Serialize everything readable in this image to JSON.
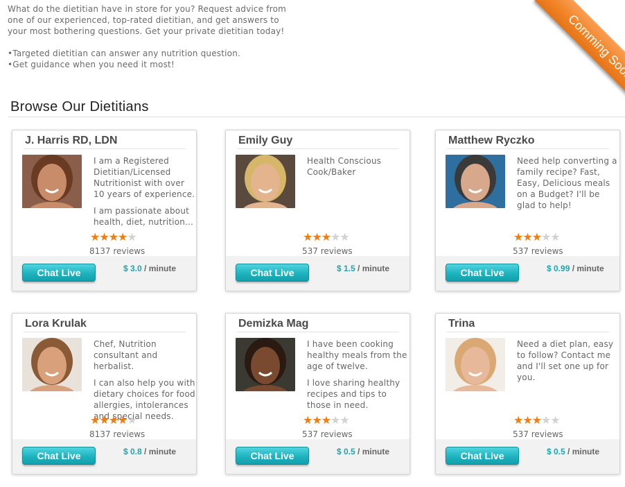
{
  "intro": {
    "paragraph": "What do the dietitian have in store for you? Request advice from one of our experienced, top-rated dietitian, and get answers to your most bothering questions. Get your private dietitian today!",
    "bullet_1": "•Targeted dietitian can answer any nutrition question.",
    "bullet_2": "•Get guidance when you need it most!"
  },
  "ribbon": {
    "label": "Comming Soon",
    "color": "#f08224"
  },
  "section_title": "Browse Our Dietitians",
  "ui": {
    "chat_label": "Chat Live",
    "per_minute": "/ minute",
    "accent": "#1eb3bf",
    "star_color": "#f07c12"
  },
  "dietitians": [
    {
      "name": "J. Harris RD, LDN",
      "desc": [
        "I am a Registered Dietitian/Licensed Nutritionist with over 10 years of experience.",
        "I am passionate about health, diet, nutrition..."
      ],
      "rating": 4,
      "reviews": "8137 reviews",
      "price": "$ 3.0",
      "skin": "#c98c6a",
      "hair": "#6a3a22",
      "bg": "#8a5e4a"
    },
    {
      "name": "Emily Guy",
      "desc": [
        "Health Conscious Cook/Baker"
      ],
      "rating": 3,
      "reviews": "537 reviews",
      "price": "$ 1.5",
      "skin": "#e3b48e",
      "hair": "#d6b76a",
      "bg": "#5a4a3e"
    },
    {
      "name": "Matthew Ryczko",
      "desc": [
        "Need help converting a family recipe? Fast, Easy, Delicious meals on a Budget? I'll be glad to help!"
      ],
      "rating": 3,
      "reviews": "537 reviews",
      "price": "$ 0.99",
      "skin": "#d8a88c",
      "hair": "#3a3a3a",
      "bg": "#2e6fa0"
    },
    {
      "name": "Lora Krulak",
      "desc": [
        "Chef, Nutrition consultant and herbalist.",
        "I can also help you with dietary choices for food allergies, intolerances and special needs."
      ],
      "rating": 4,
      "reviews": "8137 reviews",
      "price": "$ 0.8",
      "skin": "#d9a07c",
      "hair": "#8a5a36",
      "bg": "#e9e2da"
    },
    {
      "name": "Demizka Mag",
      "desc": [
        "I have been cooking healthy meals from the age of twelve.",
        "I love sharing healthy recipes and tips to those in need."
      ],
      "rating": 3,
      "reviews": "537 reviews",
      "price": "$ 0.5",
      "skin": "#7a4a30",
      "hair": "#2a1a12",
      "bg": "#3a3a32"
    },
    {
      "name": "Trina",
      "desc": [
        "Need a diet plan, easy to follow? Contact me and I'll set one up for you."
      ],
      "rating": 3,
      "reviews": "537 reviews",
      "price": "$ 0.5",
      "skin": "#e8b89a",
      "hair": "#d9a873",
      "bg": "#f2ede6"
    }
  ]
}
